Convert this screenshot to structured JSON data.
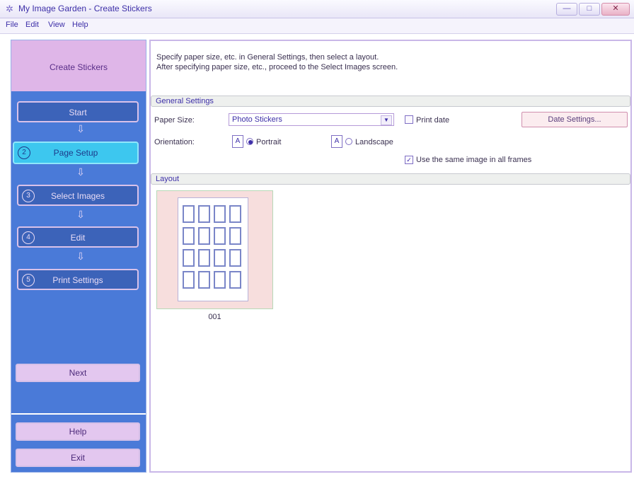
{
  "window": {
    "title": "My Image Garden - Create Stickers",
    "minimize": "—",
    "maximize": "□",
    "close": "✕"
  },
  "menu": [
    "File",
    "Edit",
    "View",
    "Help"
  ],
  "left_pane": {
    "header": "Create Stickers",
    "steps": [
      {
        "label": "Start",
        "icon": "1",
        "active": false
      },
      {
        "label": "Page Setup",
        "icon": "2",
        "active": true
      },
      {
        "label": "Select Images",
        "icon": "3",
        "active": false
      },
      {
        "label": "Edit",
        "icon": "4",
        "active": false
      },
      {
        "label": "Print Settings",
        "icon": "5",
        "active": false
      }
    ],
    "next_button": "Next",
    "help_button": "Help",
    "exit_button": "Exit"
  },
  "instructions": {
    "line1": "Specify paper size, etc. in General Settings, then select a layout.",
    "line2": "After specifying paper size, etc., proceed to the Select Images screen."
  },
  "general_settings": {
    "header": "General Settings",
    "paper_size_label": "Paper Size:",
    "paper_size_value": "Photo Stickers",
    "print_date_label": "Print date",
    "print_date_checked": false,
    "date_settings_button": "Date Settings...",
    "orientation_label": "Orientation:",
    "portrait_label": "Portrait",
    "landscape_label": "Landscape",
    "orientation_selected": "portrait",
    "same_image_label": "Use the same image in all frames",
    "same_image_checked": true
  },
  "layout": {
    "header": "Layout",
    "items": [
      {
        "label": "001",
        "rows": 4,
        "cols": 4
      }
    ]
  }
}
